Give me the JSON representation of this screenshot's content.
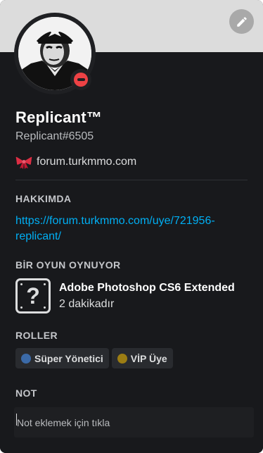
{
  "profile": {
    "username": "Replicant™",
    "tag": "Replicant#6505",
    "custom_status": "forum.turkmmo.com",
    "status": "dnd",
    "status_color": "#ed4245",
    "custom_status_icon": "ribbon-bow-icon",
    "edit_icon": "pencil-icon"
  },
  "sections": {
    "about_title": "HAKKIMDA",
    "about_link": "https://forum.turkmmo.com/uye/721956-replicant/",
    "playing_title": "BİR OYUN OYNUYOR",
    "roles_title": "ROLLER",
    "note_title": "NOT"
  },
  "game": {
    "name": "Adobe Photoshop CS6 Extended",
    "elapsed": "2 dakikadır",
    "icon": "unknown-game-icon"
  },
  "roles": [
    {
      "name": "Süper Yönetici",
      "color": "#3b6aa8"
    },
    {
      "name": "VİP Üye",
      "color": "#9c7d13"
    }
  ],
  "note": {
    "placeholder": "Not eklemek için tıkla",
    "value": ""
  }
}
